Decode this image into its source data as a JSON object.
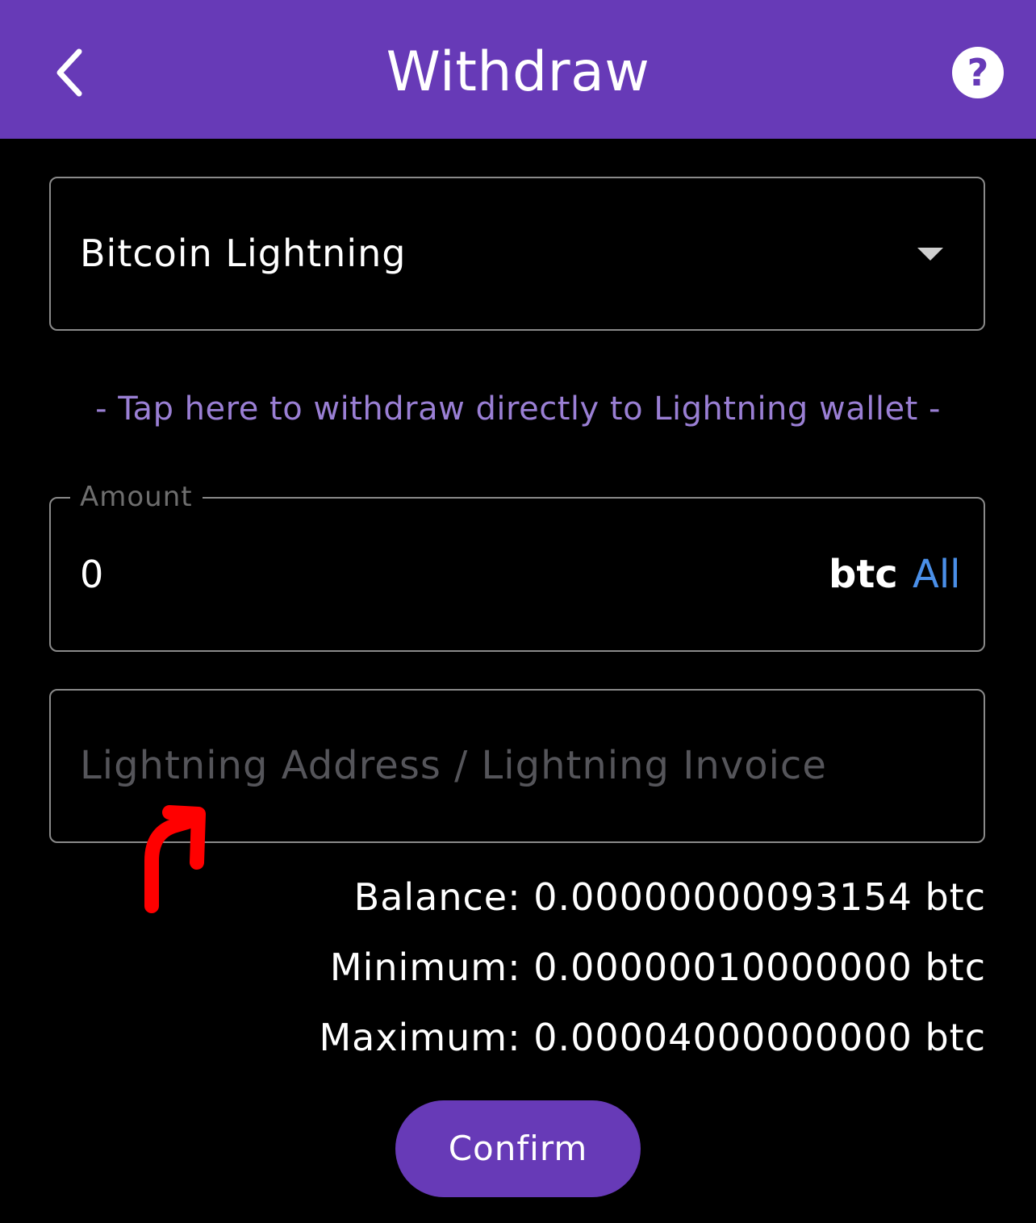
{
  "header": {
    "title": "Withdraw",
    "back_icon": "chevron-left-icon",
    "help_icon": "question-circle-icon",
    "help_glyph": "?"
  },
  "network_select": {
    "value": "Bitcoin Lightning",
    "caret_icon": "caret-down-icon"
  },
  "direct_link": {
    "label": "- Tap here to withdraw directly to Lightning wallet -"
  },
  "amount": {
    "legend": "Amount",
    "value": "0",
    "unit": "btc",
    "all_label": "All"
  },
  "address": {
    "placeholder": "Lightning Address / Lightning Invoice"
  },
  "info": {
    "balance": "Balance: 0.00000000093154 btc",
    "minimum": "Minimum: 0.00000010000000 btc",
    "maximum": "Maximum: 0.00004000000000 btc"
  },
  "confirm": {
    "label": "Confirm"
  },
  "colors": {
    "header_bg": "#673ab7",
    "link_text": "#9a7fd4",
    "all_text": "#4a8fe8",
    "annotation": "#ff0000"
  }
}
